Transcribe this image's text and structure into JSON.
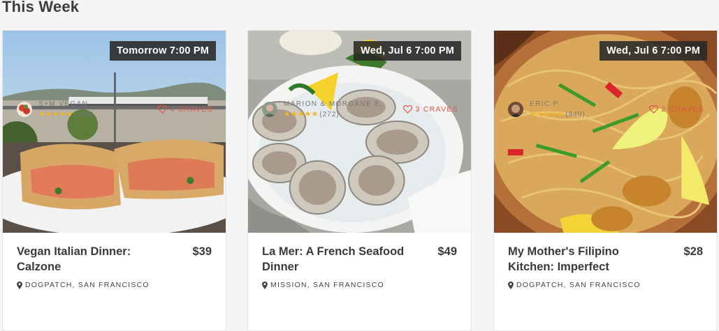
{
  "section": {
    "title": "This Week"
  },
  "colors": {
    "accent": "#e0524a",
    "star": "#f3b61f",
    "badge_bg": "#282828"
  },
  "cards": [
    {
      "date": "Tomorrow 7:00 PM",
      "title": "Vegan Italian Dinner: Calzone",
      "price": "$39",
      "location": "DOGPATCH, SAN FRANCISCO",
      "host": "S+M VEGAN",
      "stars": "★★★★★",
      "reviews": "(440)",
      "craves": "4 CRAVES",
      "image": "calzone-photo"
    },
    {
      "date": "Wed, Jul 6 7:00 PM",
      "title": "La Mer: A French Seafood Dinner",
      "price": "$49",
      "location": "MISSION, SAN FRANCISCO",
      "host": "MARION & MORGANE E.",
      "stars": "★★★★★",
      "reviews": "(272)",
      "craves": "3 CRAVES",
      "image": "oysters-photo"
    },
    {
      "date": "Wed, Jul 6 7:00 PM",
      "title": "My Mother's Filipino Kitchen: Imperfect",
      "price": "$28",
      "location": "DOGPATCH, SAN FRANCISCO",
      "host": "ERIC P.",
      "stars": "★★★★★",
      "reviews": "(940)",
      "craves": "2 CRAVES",
      "image": "noodles-photo"
    }
  ]
}
